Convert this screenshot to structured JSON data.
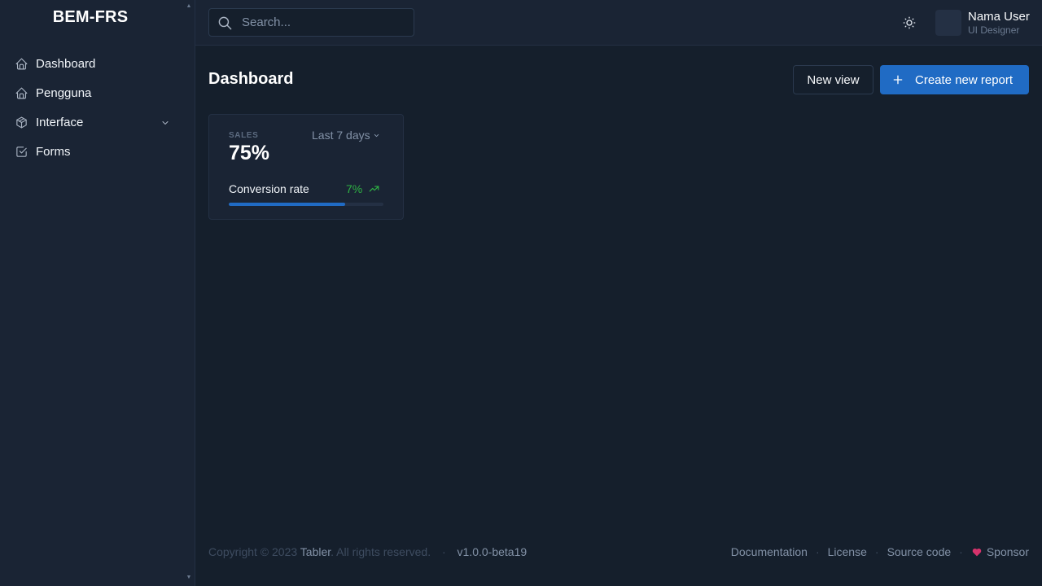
{
  "sidebar": {
    "brand": "BEM-FRS",
    "items": [
      {
        "label": "Dashboard",
        "icon": "home-icon"
      },
      {
        "label": "Pengguna",
        "icon": "home-icon"
      },
      {
        "label": "Interface",
        "icon": "package-icon",
        "has_submenu": true
      },
      {
        "label": "Forms",
        "icon": "checkbox-icon"
      }
    ]
  },
  "header": {
    "search": {
      "placeholder": "Search...",
      "value": ""
    },
    "theme_icon": "sun-icon",
    "user": {
      "name": "Nama User",
      "role": "UI Designer"
    }
  },
  "page": {
    "title": "Dashboard",
    "actions": {
      "secondary_label": "New view",
      "primary_label": "Create new report",
      "primary_icon": "plus-icon"
    }
  },
  "card": {
    "subheader": "SALES",
    "period": "Last 7 days",
    "value": "75%",
    "metric_label": "Conversion rate",
    "delta": "7%",
    "delta_icon": "trending-up-icon",
    "progress_percent": 75
  },
  "footer": {
    "copyright_prefix": "Copyright © 2023",
    "brand_link": "Tabler",
    "rights": ". All rights reserved.",
    "dot": "·",
    "version": "v1.0.0-beta19",
    "links": [
      "Documentation",
      "License",
      "Source code",
      "Sponsor"
    ]
  },
  "colors": {
    "background": "#151f2c",
    "surface": "#1a2434",
    "primary": "#206bc4",
    "success": "#2fb344",
    "sponsor_heart": "#d6336c"
  }
}
